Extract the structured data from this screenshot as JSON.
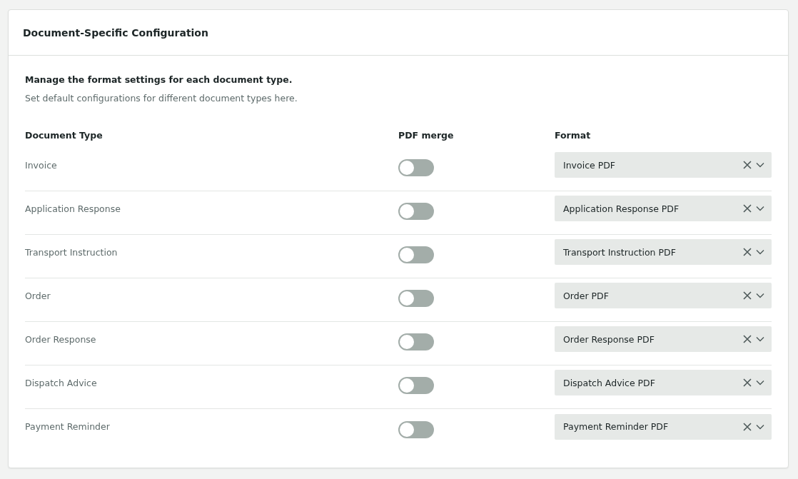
{
  "card": {
    "title": "Document-Specific Configuration"
  },
  "intro": {
    "heading": "Manage the format settings for each document type.",
    "description": "Set default configurations for different document types here."
  },
  "table": {
    "columns": [
      "Document Type",
      "PDF merge",
      "Format"
    ],
    "rows": [
      {
        "document_type": "Invoice",
        "pdf_merge": false,
        "format": "Invoice PDF"
      },
      {
        "document_type": "Application Response",
        "pdf_merge": false,
        "format": "Application Response PDF"
      },
      {
        "document_type": "Transport Instruction",
        "pdf_merge": false,
        "format": "Transport Instruction PDF"
      },
      {
        "document_type": "Order",
        "pdf_merge": false,
        "format": "Order PDF"
      },
      {
        "document_type": "Order Response",
        "pdf_merge": false,
        "format": "Order Response PDF"
      },
      {
        "document_type": "Dispatch Advice",
        "pdf_merge": false,
        "format": "Dispatch Advice PDF"
      },
      {
        "document_type": "Payment Reminder",
        "pdf_merge": false,
        "format": "Payment Reminder PDF"
      }
    ]
  }
}
